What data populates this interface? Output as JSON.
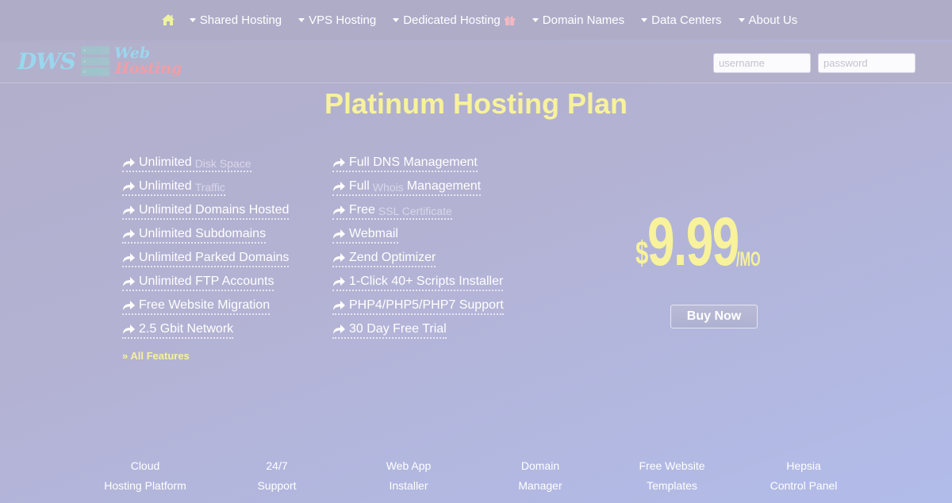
{
  "nav": {
    "home_icon": "home-icon",
    "items": [
      {
        "label": "Shared Hosting",
        "icon": "caret-down-icon"
      },
      {
        "label": "VPS Hosting",
        "icon": "caret-down-icon"
      },
      {
        "label": "Dedicated Hosting",
        "icon": "caret-down-icon",
        "badge_icon": "gift-icon"
      },
      {
        "label": "Domain Names",
        "icon": "caret-down-icon"
      },
      {
        "label": "Data Centers",
        "icon": "caret-down-icon"
      },
      {
        "label": "About Us",
        "icon": "caret-down-icon"
      }
    ]
  },
  "header": {
    "logo": {
      "primary": "DWS",
      "line1": "Web",
      "line2": "Hosting",
      "icon": "server-icon"
    },
    "login": {
      "username_placeholder": "username",
      "username_value": "",
      "password_placeholder": "password",
      "password_value": ""
    }
  },
  "plan": {
    "title": "Platinum Hosting Plan",
    "features_col1": [
      {
        "main": "Unlimited",
        "sub": "Disk Space",
        "tail": ""
      },
      {
        "main": "Unlimited",
        "sub": "Traffic",
        "tail": ""
      },
      {
        "main": "Unlimited Domains Hosted",
        "sub": "",
        "tail": ""
      },
      {
        "main": "Unlimited Subdomains",
        "sub": "",
        "tail": ""
      },
      {
        "main": "Unlimited Parked Domains",
        "sub": "",
        "tail": ""
      },
      {
        "main": "Unlimited FTP Accounts",
        "sub": "",
        "tail": ""
      },
      {
        "main": "Free Website Migration",
        "sub": "",
        "tail": ""
      },
      {
        "main": "2.5 Gbit Network",
        "sub": "",
        "tail": ""
      }
    ],
    "features_col2": [
      {
        "main": "Full DNS Management",
        "sub": "",
        "tail": ""
      },
      {
        "main": "Full",
        "sub": "Whois",
        "tail": "Management"
      },
      {
        "main": "Free",
        "sub": "SSL Certificate",
        "tail": ""
      },
      {
        "main": "Webmail",
        "sub": "",
        "tail": ""
      },
      {
        "main": "Zend Optimizer",
        "sub": "",
        "tail": ""
      },
      {
        "main": "1-Click 40+ Scripts Installer",
        "sub": "",
        "tail": ""
      },
      {
        "main": "PHP4/PHP5/PHP7 Support",
        "sub": "",
        "tail": ""
      },
      {
        "main": "30 Day Free Trial",
        "sub": "",
        "tail": ""
      }
    ],
    "all_features_label": "» All Features",
    "price": {
      "currency": "$",
      "amount": "9.99",
      "period": "/MO"
    },
    "buy_label": "Buy Now"
  },
  "footer": {
    "links": [
      {
        "line1": "Cloud",
        "line2": "Hosting Platform"
      },
      {
        "line1": "24/7",
        "line2": "Support"
      },
      {
        "line1": "Web App",
        "line2": "Installer"
      },
      {
        "line1": "Domain",
        "line2": "Manager"
      },
      {
        "line1": "Free Website",
        "line2": "Templates"
      },
      {
        "line1": "Hepsia",
        "line2": "Control Panel"
      }
    ]
  },
  "colors": {
    "accent_yellow": "#f7f29b",
    "logo_blue": "#9ad7ee",
    "logo_pink": "#f09ea6",
    "nav_bg": "#afacc8"
  }
}
